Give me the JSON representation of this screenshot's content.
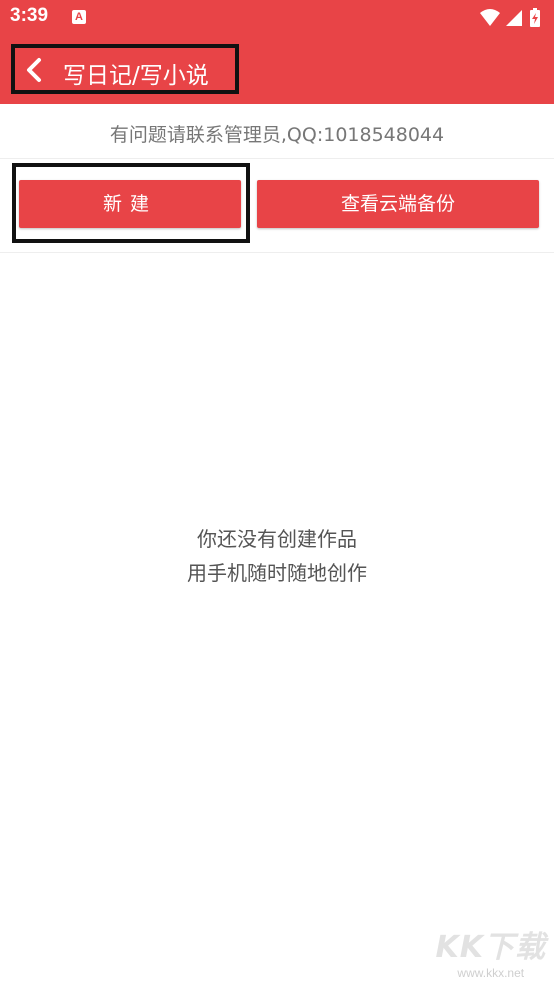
{
  "status_bar": {
    "time": "3:39",
    "notification_glyph": "A",
    "icons": [
      "wifi-icon",
      "signal-icon",
      "battery-icon"
    ]
  },
  "app_bar": {
    "title": "写日记/写小说",
    "back_icon": "back-arrow-icon",
    "color": "#e84447"
  },
  "notice": {
    "text": "有问题请联系管理员,QQ:1018548044"
  },
  "buttons": {
    "new_label": "新建",
    "cloud_label": "查看云端备份"
  },
  "empty_state": {
    "line1": "你还没有创建作品",
    "line2": "用手机随时随地创作"
  },
  "watermark": {
    "logo": "KK下载",
    "url": "www.kkx.net"
  }
}
